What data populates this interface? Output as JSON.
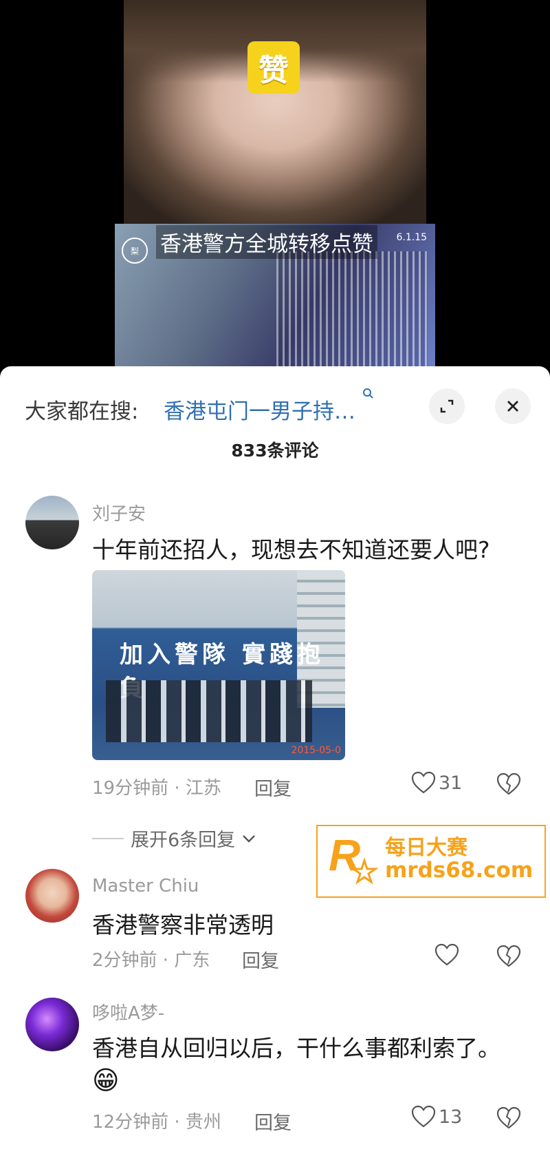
{
  "video": {
    "sticker_text": "赞",
    "caption": "香港警方全城转移点赞",
    "date_fragment": "6.1.15",
    "logo_text": "梨"
  },
  "sheet": {
    "search_prefix": "大家都在搜:",
    "search_term": "香港屯门一男子持…",
    "comment_count": "833条评论"
  },
  "comments": [
    {
      "username": "刘子安",
      "text": "十年前还招人，现想去不知道还要人吧?",
      "image": {
        "banner": "加入警隊 實踐抱負",
        "stamp": "2015-05-0"
      },
      "meta": "19分钟前 · 江苏",
      "reply": "回复",
      "likes": "31",
      "expand": "展开6条回复"
    },
    {
      "username": "Master Chiu",
      "text": "香港警察非常透明",
      "meta": "2分钟前 · 广东",
      "reply": "回复",
      "likes": ""
    },
    {
      "username": "哆啦A梦-",
      "text": "香港自从回归以后，干什么事都利索了。",
      "emoji": "😁",
      "meta": "12分钟前 · 贵州",
      "reply": "回复",
      "likes": "13"
    }
  ],
  "watermark": {
    "name": "每日大赛",
    "url": "mrds68.com",
    "logo_letter": "R"
  },
  "colors": {
    "accent_link": "#2f6fb1",
    "watermark": "#f7a21a"
  }
}
